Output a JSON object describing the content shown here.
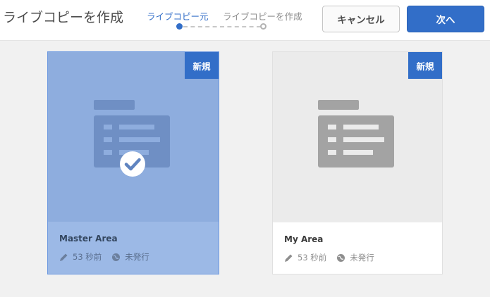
{
  "header": {
    "title": "ライブコピーを作成",
    "steps": [
      {
        "label": "ライブコピー元",
        "state": "current"
      },
      {
        "label": "ライブコピーを作成",
        "state": "upcoming"
      }
    ],
    "cancel_label": "キャンセル",
    "next_label": "次へ"
  },
  "cards": [
    {
      "name": "Master Area",
      "badge": "新規",
      "modified": "53 秒前",
      "status": "未発行",
      "selected": true
    },
    {
      "name": "My Area",
      "badge": "新規",
      "modified": "53 秒前",
      "status": "未発行",
      "selected": false
    }
  ],
  "colors": {
    "accent": "#326ec8",
    "selected_card_bg": "#9cb9e6",
    "placeholder_bg": "#ebebeb"
  },
  "icons": {
    "thumbnail": "folder-icon",
    "selected": "checkmark-icon",
    "modified": "pencil-icon",
    "status": "globe-icon"
  }
}
